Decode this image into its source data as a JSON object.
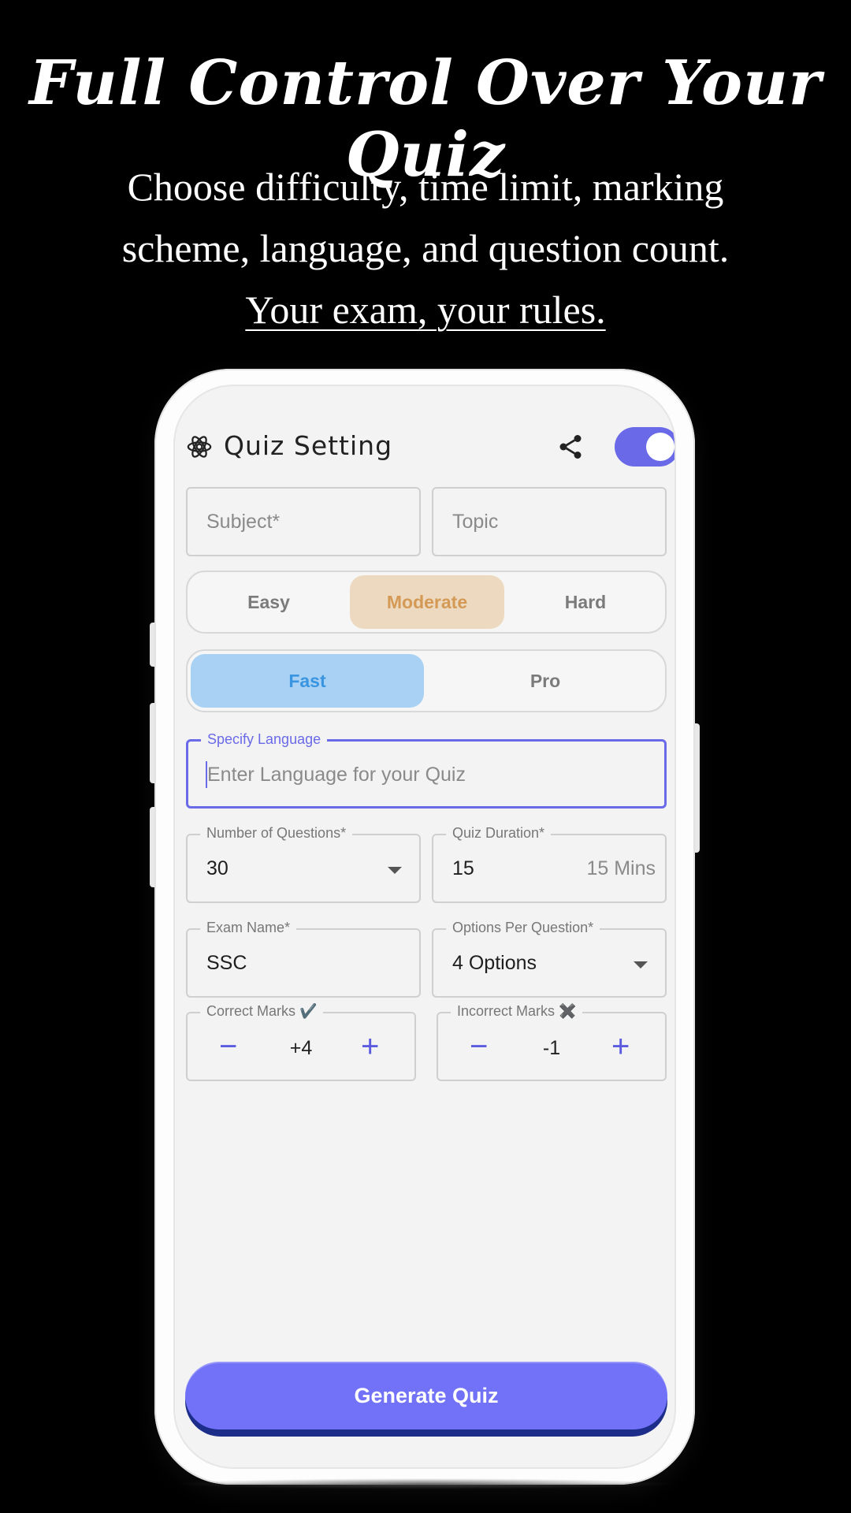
{
  "promo": {
    "headline": "Full Control Over Your Quiz",
    "line1": "Choose difficulty, time limit, marking",
    "line2": "scheme, language, and question count.",
    "line3": "Your exam, your rules."
  },
  "appbar": {
    "title": "Quiz Setting",
    "icon": "gear-icon",
    "share_icon": "share-icon",
    "toggle_on": true,
    "accent": "#6a6ae8"
  },
  "form": {
    "subject_placeholder": "Subject*",
    "topic_placeholder": "Topic",
    "difficulty": {
      "options": [
        "Easy",
        "Moderate",
        "Hard"
      ],
      "selected": "Moderate",
      "selected_bg": "#ecd9c0",
      "selected_color": "#d49a55"
    },
    "mode": {
      "options": [
        "Fast",
        "Pro"
      ],
      "selected": "Fast",
      "selected_bg": "#a9d1f4",
      "selected_color": "#3a95e0"
    },
    "language": {
      "label": "Specify Language",
      "placeholder": "Enter Language for your Quiz"
    },
    "num_questions": {
      "label": "Number of Questions*",
      "value": "30"
    },
    "duration": {
      "label": "Quiz Duration*",
      "value": "15",
      "suffix": "15 Mins"
    },
    "exam_name": {
      "label": "Exam Name*",
      "value": "SSC"
    },
    "options_per_question": {
      "label": "Options Per Question*",
      "value": "4 Options"
    },
    "correct_marks": {
      "label": "Correct Marks ✔️",
      "value": "+4"
    },
    "incorrect_marks": {
      "label": "Incorrect Marks ✖️",
      "value": "-1"
    }
  },
  "generate_button": {
    "label": "Generate Quiz",
    "color": "#7272f8"
  }
}
